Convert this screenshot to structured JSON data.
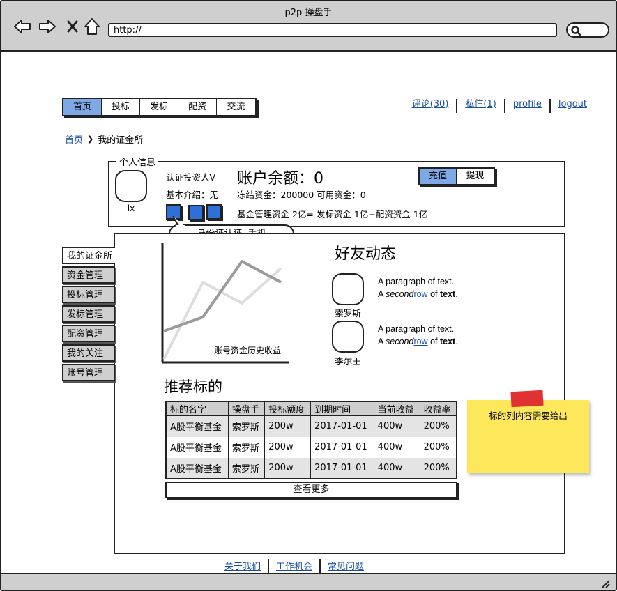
{
  "window": {
    "title": "p2p 操盘手",
    "url": "http://"
  },
  "topnav": {
    "items": [
      "首页",
      "投标",
      "发标",
      "配资",
      "交流"
    ],
    "active_index": 0
  },
  "usernav": {
    "items": [
      "评论(30)",
      "私信(1)",
      "profile",
      "logout"
    ]
  },
  "breadcrumb": {
    "home": "首页",
    "separator": "❯",
    "current": "我的证金所"
  },
  "info": {
    "legend": "个人信息",
    "username": "lx",
    "verified": "认证投资人V",
    "intro": "基本介绍：无",
    "balance": "账户余额：0",
    "frozen": "冻结资金：200000 可用资金：0",
    "fund_summary": "基金管理资金 2亿= 发标资金 1亿+配资资金 1亿",
    "tooltip": "身份证认证, 手机",
    "recharge": "充值",
    "withdraw": "提现"
  },
  "sidenav": {
    "items": [
      "我的证金所",
      "资金管理",
      "投标管理",
      "发标管理",
      "配资管理",
      "我的关注",
      "账号管理"
    ],
    "active_index": 0
  },
  "chart": {
    "label": "账号资金历史收益"
  },
  "chart_data": {
    "type": "line",
    "title": "账号资金历史收益",
    "xlabel": "",
    "ylabel": "",
    "x": [
      0,
      1,
      2,
      3
    ],
    "series": [
      {
        "values": [
          1,
          2,
          6,
          4.5
        ],
        "color": "#9a9a9a"
      },
      {
        "values": [
          -1,
          4.5,
          3,
          5.5
        ],
        "color": "#dddddd"
      }
    ],
    "ylim": [
      -1,
      7
    ],
    "grid": false
  },
  "friends": {
    "title": "好友动态",
    "items": [
      {
        "name": "索罗斯",
        "line1": "A paragraph of text.",
        "line2_pre": "A ",
        "line2_em": "second",
        "line2_link": "row",
        "line2_mid": " of ",
        "line2_bold": "text",
        "line2_end": "."
      },
      {
        "name": "李尔王",
        "line1": "A paragraph of text.",
        "line2_pre": "A ",
        "line2_em": "second",
        "line2_link": "row",
        "line2_mid": " of ",
        "line2_bold": "text",
        "line2_end": "."
      }
    ]
  },
  "recommend": {
    "title": "推荐标的",
    "columns": [
      "标的名字",
      "操盘手",
      "投标额度",
      "到期时间",
      "当前收益",
      "收益率"
    ],
    "rows": [
      [
        "A股平衡基金",
        "索罗斯",
        "200w",
        "2017-01-01",
        "400w",
        "200%"
      ],
      [
        "A股平衡基金",
        "索罗斯",
        "200w",
        "2017-01-01",
        "400w",
        "200%"
      ],
      [
        "A股平衡基金",
        "索罗斯",
        "200w",
        "2017-01-01",
        "400w",
        "200%"
      ]
    ],
    "more": "查看更多"
  },
  "sticky": {
    "text": "标的列内容需要给出"
  },
  "footer": {
    "items": [
      "关于我们",
      "工作机会",
      "常见问题"
    ]
  }
}
